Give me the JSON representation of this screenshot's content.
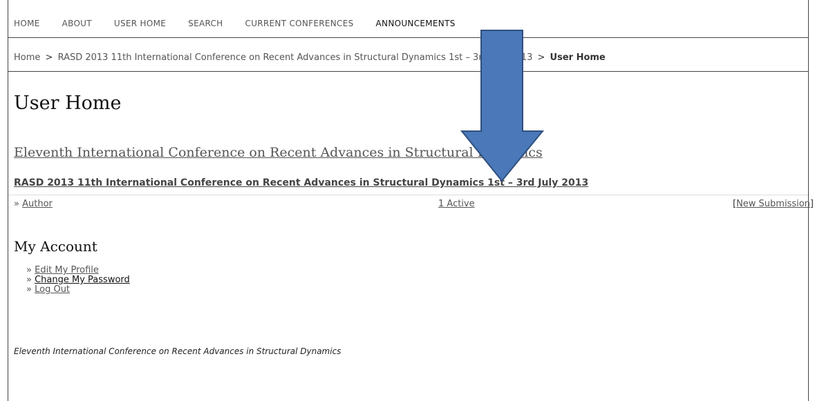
{
  "nav": {
    "items": [
      "HOME",
      "ABOUT",
      "USER HOME",
      "SEARCH",
      "CURRENT CONFERENCES",
      "ANNOUNCEMENTS"
    ]
  },
  "breadcrumb": {
    "home": "Home",
    "conference": "RASD 2013 11th International Conference on Recent Advances in Structural Dynamics 1st – 3rd July 2013",
    "current": "User Home",
    "separator": ">"
  },
  "main": {
    "title": "User Home",
    "conference_title": "Eleventh International Conference on Recent Advances in Structural Dynamics",
    "sched_conf_title": "RASD 2013 11th International Conference on Recent Advances in Structural Dynamics 1st – 3rd July 2013",
    "role_prefix": "»",
    "role": "Author",
    "active_count": "1 Active",
    "new_submission": "New Submission",
    "bracket_open": "[",
    "bracket_close": "]"
  },
  "account": {
    "title": "My Account",
    "prefix": "»",
    "edit_profile": "Edit My Profile",
    "change_password": "Change My Password",
    "log_out": "Log Out"
  },
  "footer": {
    "text": "Eleventh International Conference on Recent Advances in Structural Dynamics"
  },
  "annotation": {
    "arrow_fill": "#4a78b8",
    "arrow_stroke": "#2f4f7f"
  }
}
